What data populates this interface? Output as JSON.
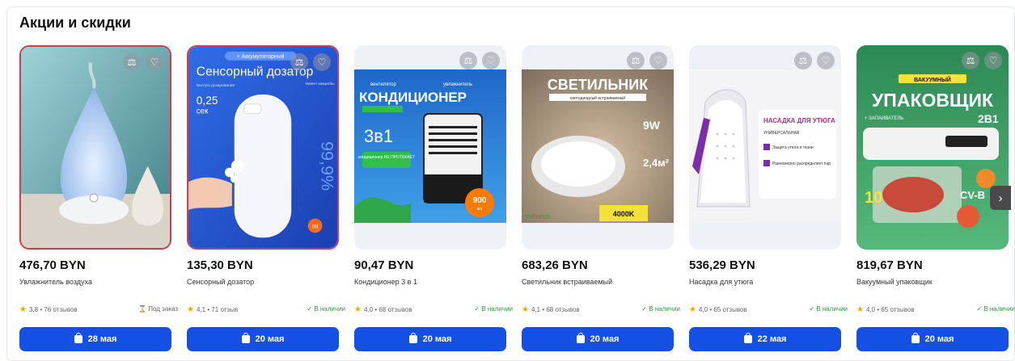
{
  "section": {
    "title": "Акции и скидки"
  },
  "icons": {
    "compare": "scales-icon",
    "favorite": "heart-icon",
    "rating": "star-icon",
    "cart": "bag-icon",
    "next": "chevron-right-icon"
  },
  "colors": {
    "button": "#1450e6",
    "star": "#f2a600",
    "in_stock": "#2a9d3c",
    "highlight_border": "#d63a4e"
  },
  "products": [
    {
      "price": "476,70 BYN",
      "name": "Увлажнитель воздуха",
      "rating": "3,8 • 76 отзывов",
      "availability": "Под заказ",
      "delivery": "28 мая",
      "image": {}
    },
    {
      "price": "135,30 BYN",
      "name": "Сенсорный дозатор",
      "rating": "4,1 • 71 отзыв",
      "availability": "✓ В наличии",
      "delivery": "20 мая",
      "image": {
        "banner": "+ Аккумуляторный",
        "title": "Сенсорный дозатор",
        "speed_label": "Быстро дозирование",
        "speed": "0,25",
        "speed_unit": "сек",
        "side": "Имеет микробы",
        "percent": "99,9%",
        "brand": "mi"
      }
    },
    {
      "price": "90,47 BYN",
      "name": "Кондиционер 3 в 1",
      "rating": "4,0 • 68 отзывов",
      "availability": "✓ В наличии",
      "delivery": "20 мая",
      "image": {
        "top_left": "вентилятор",
        "top_right": "увлажнитель",
        "title": "КОНДИЦИОНЕР",
        "badge": "3в1",
        "note": "кондиционер НЕ ПРОТЕКАЕТ",
        "volume": "900",
        "volume_unit": "мл"
      }
    },
    {
      "price": "683,26 BYN",
      "name": "Светильник встраиваемый",
      "rating": "4,1 • 68 отзывов",
      "availability": "✓ В наличии",
      "delivery": "20 мая",
      "image": {
        "title": "СВЕТИЛЬНИК",
        "subtitle": "светодиодный встраиваемый",
        "power": "9W",
        "area": "2,4м²",
        "temp": "4000K",
        "brand": "truEnergy"
      }
    },
    {
      "price": "536,29 BYN",
      "name": "Насадка для утюга",
      "rating": "4,0 • 65 отзывов",
      "availability": "✓ В наличии",
      "delivery": "22 мая",
      "image": {
        "title": "НАСАДКА ДЛЯ УТЮГА",
        "subtitle": "УНИВЕРСАЛЬНАЯ",
        "feature1": "Защита утюга и ткани",
        "feature2": "Равномерно распределяет пар"
      }
    },
    {
      "price": "819,67 BYN",
      "name": "Вакуумный упаковщик",
      "rating": "4,0 • 65 отзывов",
      "availability": "✓ В наличии",
      "delivery": "20 мая",
      "image": {
        "top": "ВАКУУМНЫЙ",
        "title": "УПАКОВЩИК",
        "sub": "+ ЗАПАИВАТЕЛЬ",
        "badge": "2В1",
        "model": "CV-B",
        "count": "10"
      }
    }
  ]
}
